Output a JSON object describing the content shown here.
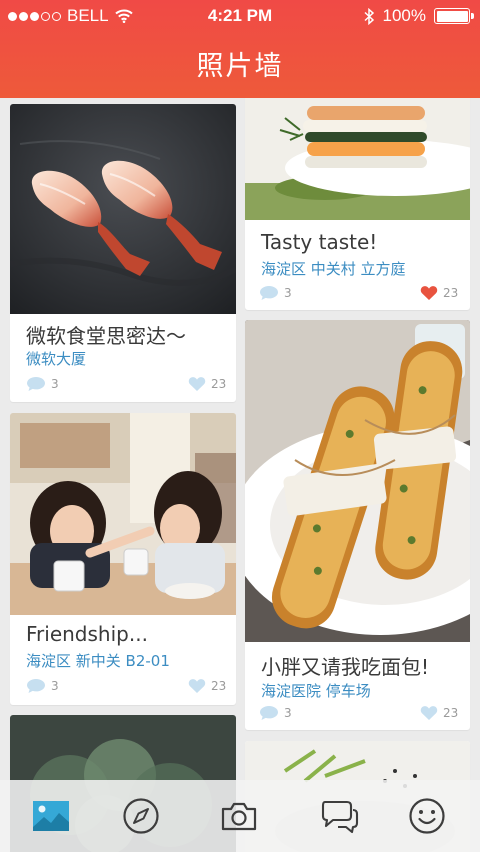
{
  "status_bar": {
    "carrier": "BELL",
    "time": "4:21 PM",
    "battery": "100%"
  },
  "header": {
    "title": "照片墙"
  },
  "feed": {
    "left_column": [
      {
        "title": "微软食堂思密达～",
        "location": "微软大厦",
        "comments": "3",
        "likes": "23",
        "liked": false
      },
      {
        "title": "Friendship...",
        "location": "海淀区 新中关 B2-01",
        "comments": "3",
        "likes": "23",
        "liked": false
      }
    ],
    "right_column": [
      {
        "title": "Tasty taste!",
        "location": "海淀区 中关村 立方庭",
        "comments": "3",
        "likes": "23",
        "liked": true
      },
      {
        "title": "小胖又请我吃面包!",
        "location": "海淀医院 停车场",
        "comments": "3",
        "likes": "23",
        "liked": false
      }
    ]
  },
  "tab_bar": {
    "items": [
      {
        "icon": "photo-icon",
        "active": true
      },
      {
        "icon": "compass-icon",
        "active": false
      },
      {
        "icon": "camera-icon",
        "active": false
      },
      {
        "icon": "chat-bubbles-icon",
        "active": false
      },
      {
        "icon": "smiley-icon",
        "active": false
      }
    ]
  },
  "colors": {
    "header_red": "#f04a46",
    "location_blue": "#3c8dc2",
    "like_red": "#e8533f",
    "active_tab": "#35a8d6",
    "tab_icon": "#3d3d3d"
  }
}
